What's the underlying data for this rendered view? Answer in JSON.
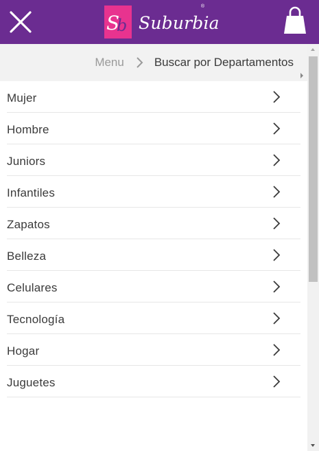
{
  "header": {
    "brand_name": "Suburbia",
    "brand_badge": "Sb",
    "brand_reg": "®",
    "colors": {
      "background": "#6b2c91",
      "badge": "#e8338f",
      "icon": "#ffffff"
    }
  },
  "breadcrumb": {
    "root_label": "Menu",
    "current_label": "Buscar por Departamentos"
  },
  "departments": [
    {
      "label": "Mujer"
    },
    {
      "label": "Hombre"
    },
    {
      "label": "Juniors"
    },
    {
      "label": "Infantiles"
    },
    {
      "label": "Zapatos"
    },
    {
      "label": "Belleza"
    },
    {
      "label": "Celulares"
    },
    {
      "label": "Tecnología"
    },
    {
      "label": "Hogar"
    },
    {
      "label": "Juguetes"
    }
  ]
}
